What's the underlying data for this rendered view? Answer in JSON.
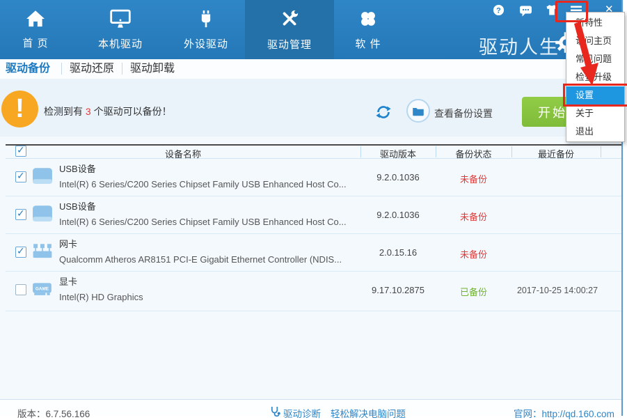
{
  "window": {
    "close_glyph": "✕"
  },
  "nav": {
    "brand": "驱动人生",
    "items": [
      {
        "label": "首 页"
      },
      {
        "label": "本机驱动"
      },
      {
        "label": "外设驱动"
      },
      {
        "label": "驱动管理",
        "active": true
      },
      {
        "label": "软 件"
      }
    ]
  },
  "tabs": {
    "items": [
      {
        "label": "驱动备份",
        "active": true
      },
      {
        "label": "驱动还原"
      },
      {
        "label": "驱动卸载"
      }
    ]
  },
  "infobar": {
    "warn_glyph": "!",
    "msg_prefix": "检测到有 ",
    "msg_count": "3",
    "msg_suffix": " 个驱动可以备份！",
    "view_backup_settings": "查看备份设置",
    "start_backup": "开始备份"
  },
  "table": {
    "header_checked": true,
    "check_glyph": "✓",
    "headers": {
      "device": "设备名称",
      "version": "驱动版本",
      "status": "备份状态",
      "last": "最近备份"
    },
    "rows": [
      {
        "title": "USB设备",
        "subtitle": "Intel(R) 6 Series/C200 Series Chipset Family USB Enhanced Host Co...",
        "version": "9.2.0.1036",
        "status": "未备份",
        "last": "",
        "checked": true,
        "unbacked": true
      },
      {
        "title": "USB设备",
        "subtitle": "Intel(R) 6 Series/C200 Series Chipset Family USB Enhanced Host Co...",
        "version": "9.2.0.1036",
        "status": "未备份",
        "last": "",
        "checked": true,
        "unbacked": true
      },
      {
        "title": "网卡",
        "subtitle": "Qualcomm Atheros AR8151 PCI-E Gigabit Ethernet Controller (NDIS...",
        "version": "2.0.15.16",
        "status": "未备份",
        "last": "",
        "checked": true,
        "unbacked": true
      },
      {
        "title": "显卡",
        "subtitle": "Intel(R) HD Graphics",
        "version": "9.17.10.2875",
        "status": "已备份",
        "last": "2017-10-25 14:00:27",
        "checked": false,
        "backed": true
      }
    ]
  },
  "menu": {
    "items": [
      {
        "label": "新特性"
      },
      {
        "label": "访问主页"
      },
      {
        "label": "常见问题"
      },
      {
        "label": "检查升级"
      },
      {
        "label": "设置",
        "active": true
      },
      {
        "label": "关于"
      },
      {
        "label": "退出"
      }
    ]
  },
  "statusbar": {
    "version": "版本：6.7.56.166",
    "diag_title": "驱动诊断",
    "diag_tagline": "轻松解决电脑问题",
    "website": "官网：http://qd.160.com"
  },
  "colors": {
    "nav_blue": "#2b80c2",
    "nav_active": "#2470a8",
    "accent_blue": "#1b7ac2",
    "button_green": "#8ac33e",
    "status_red": "#e03a38",
    "status_green": "#6fb42c",
    "annotation_red": "#e8281e",
    "menu_highlight": "#1f97e0",
    "row_icon_blue": "#8fc3e9",
    "warning_orange": "#f8a722"
  }
}
